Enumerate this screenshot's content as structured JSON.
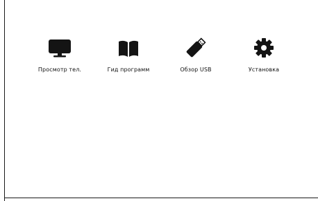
{
  "menu": {
    "items": [
      {
        "label": "Просмотр тел.",
        "icon": "tv-monitor-icon"
      },
      {
        "label": "Гид программ",
        "icon": "open-book-icon"
      },
      {
        "label": "Обзор USB",
        "icon": "usb-drive-icon"
      },
      {
        "label": "Установка",
        "icon": "gear-icon"
      }
    ]
  },
  "colors": {
    "background": "#ffffff",
    "icon": "#141414",
    "text": "#111111"
  }
}
